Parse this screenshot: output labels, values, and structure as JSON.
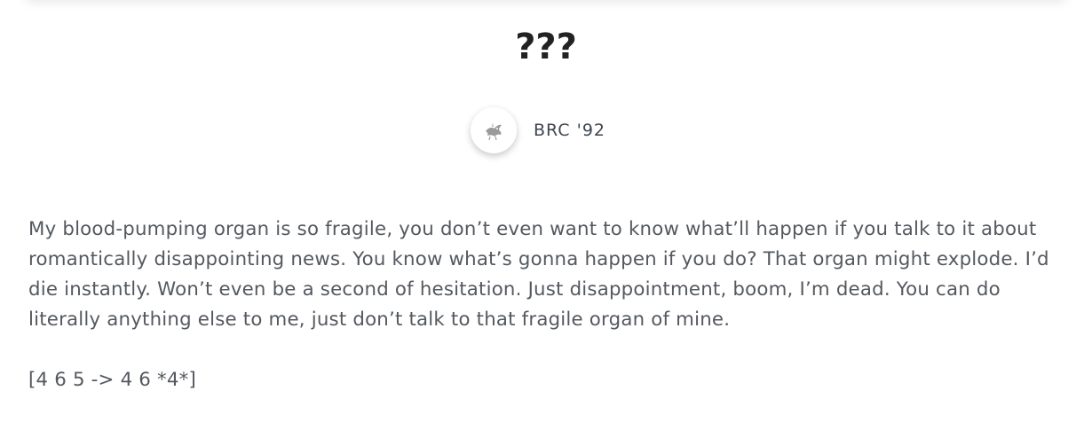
{
  "post": {
    "title": "???",
    "author": {
      "name": "BRC '92",
      "avatar_icon": "bird-logo-icon"
    },
    "paragraphs": [
      "My blood-pumping organ is so fragile, you don’t even want to know what’ll happen if you talk to it about romantically disappointing news. You know what’s gonna happen if you do? That organ might explode. I’d die instantly. Won’t even be a second of hesitation. Just disappointment, boom, I’m dead. You can do literally anything else to me, just don’t talk to that fragile organ of mine.",
      "[4 6 5 -> 4 6 *4*]"
    ]
  },
  "colors": {
    "title": "#222222",
    "body_text": "#54595f",
    "author_text": "#3f4650"
  }
}
